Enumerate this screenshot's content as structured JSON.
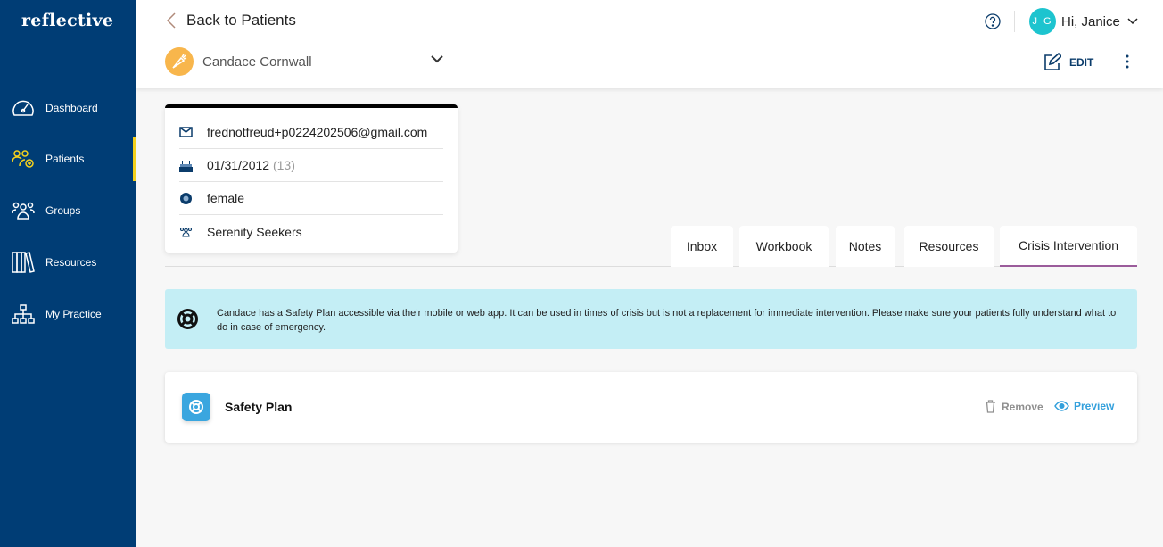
{
  "brand": "reflective",
  "sidebar": {
    "items": [
      {
        "label": "Dashboard",
        "icon": "dashboard-icon"
      },
      {
        "label": "Patients",
        "icon": "patients-icon",
        "active": true
      },
      {
        "label": "Groups",
        "icon": "groups-icon"
      },
      {
        "label": "Resources",
        "icon": "books-icon"
      },
      {
        "label": "My Practice",
        "icon": "network-icon"
      }
    ]
  },
  "header": {
    "back_label": "Back to Patients",
    "patient_name": "Candace Cornwall",
    "user_initials": "J G",
    "greeting": "Hi, Janice",
    "edit_label": "EDIT"
  },
  "patient_card": {
    "email": "frednotfreud+p0224202506@gmail.com",
    "birthdate": "01/31/2012",
    "age": "(13)",
    "gender": "female",
    "group": "Serenity Seekers"
  },
  "tabs": [
    {
      "label": "Inbox"
    },
    {
      "label": "Workbook"
    },
    {
      "label": "Notes"
    },
    {
      "label": "Resources"
    },
    {
      "label": "Crisis Intervention",
      "active": true
    }
  ],
  "alert": {
    "text": "Candace has a Safety Plan accessible via their mobile or web app. It can be used in times of crisis but is not a replacement for immediate intervention. Please make sure your patients fully understand what to do in case of emergency."
  },
  "safety_plan": {
    "title": "Safety Plan",
    "remove_label": "Remove",
    "preview_label": "Preview"
  },
  "colors": {
    "sidebar": "#003d75",
    "active_indicator": "#f5d11d",
    "tab_underline": "#9b5c9b",
    "alert_bg": "#c4eef5",
    "accent_blue": "#33a0dc",
    "avatar": "#f8b64c",
    "user_avatar": "#1dc4cf"
  }
}
